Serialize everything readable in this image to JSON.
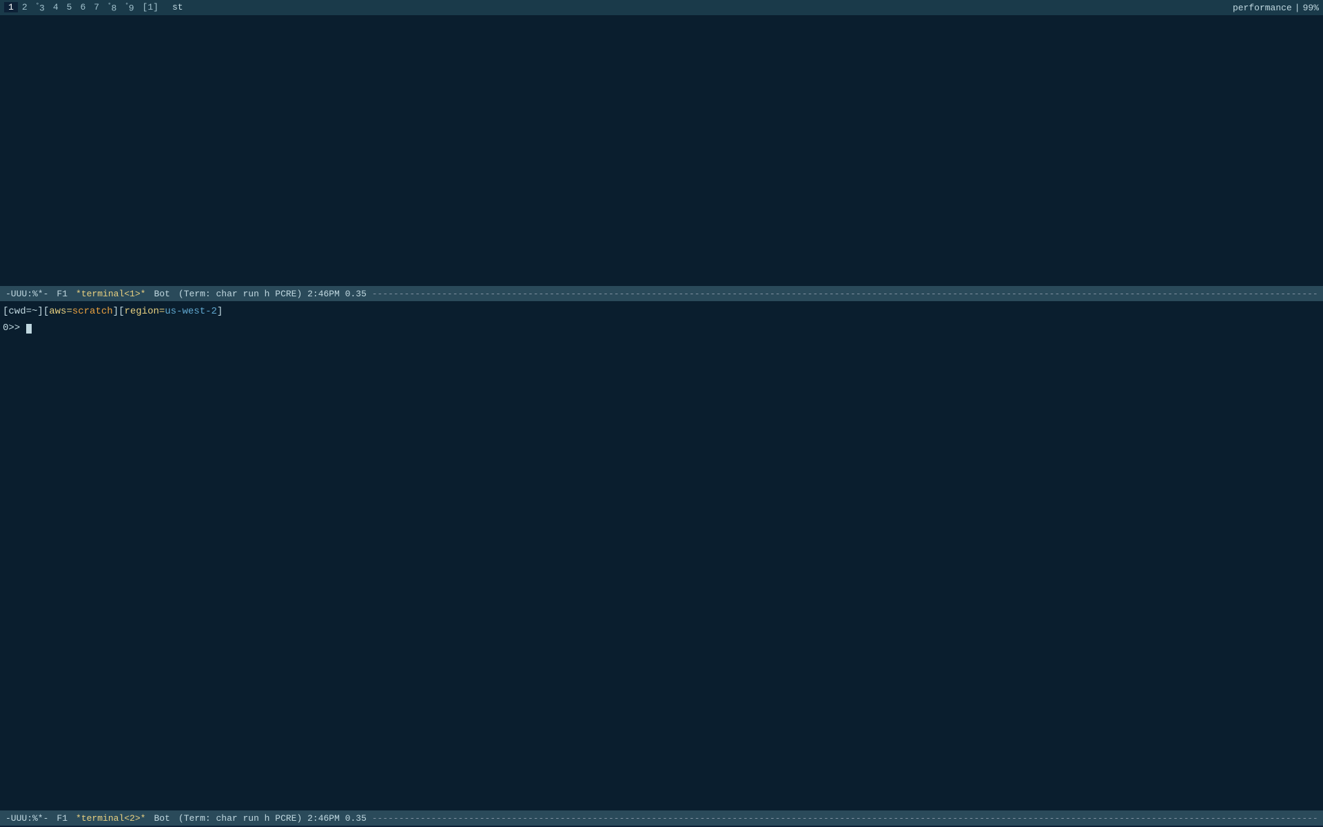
{
  "topbar": {
    "tabs": [
      {
        "label": "1",
        "active": true,
        "sup": ""
      },
      {
        "label": "2",
        "active": false,
        "sup": ""
      },
      {
        "label": "3",
        "active": false,
        "sup": "°"
      },
      {
        "label": "4",
        "active": false,
        "sup": ""
      },
      {
        "label": "5",
        "active": false,
        "sup": ""
      },
      {
        "label": "6",
        "active": false,
        "sup": ""
      },
      {
        "label": "7",
        "active": false,
        "sup": ""
      },
      {
        "label": "8",
        "active": false,
        "sup": "°"
      },
      {
        "label": "9",
        "active": false,
        "sup": "°"
      },
      {
        "label": "[1]",
        "active": false,
        "sup": ""
      }
    ],
    "title": "st",
    "performance": "performance",
    "separator": "|",
    "battery": "99%"
  },
  "status_bar_1": {
    "mode": "-UUU:%*-",
    "f1": "F1",
    "buffer": "*terminal<1>*",
    "pos": "Bot",
    "term_info": "(Term: char run h PCRE) 2:46PM 0.35"
  },
  "status_bar_2": {
    "mode": "-UUU:%*-",
    "f1": "F1",
    "buffer": "*terminal<2>*",
    "pos": "Bot",
    "term_info": "(Term: char run h PCRE) 2:46PM 0.35"
  },
  "lower_pane": {
    "prompt_line1": "[cwd=~][aws=scratch][region=us-west-2]",
    "prompt_line2": "0>> ",
    "cwd_label": "cwd=~",
    "aws_label": "aws=",
    "aws_value": "scratch",
    "region_label": "region=",
    "region_value": "us-west-2"
  }
}
